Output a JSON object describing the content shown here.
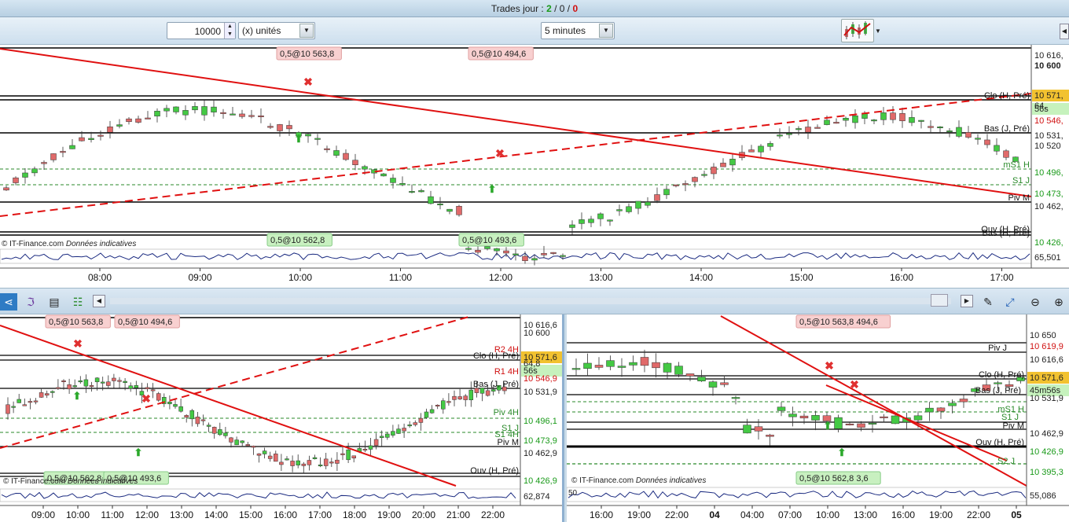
{
  "titlebar": {
    "label": "Trades jour : ",
    "win": "2",
    "sep1": " / ",
    "neutral": "0",
    "sep2": " / ",
    "loss": "0"
  },
  "toolbar": {
    "quantity": "10000",
    "unit_select": "(x) unités",
    "interval_select": "5 minutes"
  },
  "colors": {
    "up": "#44c944",
    "down": "#e06a6a",
    "trend": "#e01010",
    "accent_price": "#f2c230"
  },
  "main": {
    "watermark": "© IT-Finance.com",
    "watermark_note": "Données indicatives",
    "indicator_value": "65,501",
    "order_tags": [
      "0,5@10 563,8",
      "0,5@10 494,6",
      "0,5@10 562,8",
      "0,5@10 493,6"
    ],
    "price_labels": [
      {
        "text": "10 616,",
        "color": "#222"
      },
      {
        "text": "10 600",
        "color": "#222",
        "bold": true
      },
      {
        "text": "10 571,",
        "color": "#222",
        "highlight": true
      },
      {
        "text": "56s",
        "color": "#222",
        "green": true
      },
      {
        "text": "64,",
        "color": "#222"
      },
      {
        "text": "10 546,",
        "color": "#d01010"
      },
      {
        "text": "10 531,",
        "color": "#222"
      },
      {
        "text": "10 520",
        "color": "#222"
      },
      {
        "text": "10 496,",
        "color": "#1a9a1a"
      },
      {
        "text": "10 473,",
        "color": "#1a9a1a"
      },
      {
        "text": "10 462,",
        "color": "#222"
      },
      {
        "text": "10 426,",
        "color": "#1a9a1a"
      }
    ],
    "line_labels": [
      "Clo (H, Pré)",
      "Bas (J, Pré)",
      "mS1 H",
      "S1 J",
      "Piv M",
      "Ouv (H, Pré)",
      "Bas (H, Pré)"
    ],
    "x_labels": [
      "08:00",
      "09:00",
      "10:00",
      "11:00",
      "12:00",
      "13:00",
      "14:00",
      "15:00",
      "16:00",
      "17:00"
    ]
  },
  "bottom_left": {
    "watermark": "© IT-Finance.com",
    "watermark_note": "Données indicatives",
    "indicator_value": "62,874",
    "order_tags": [
      "0,5@10 563,8",
      "0,5@10 494,6",
      "0,5@10 562,8",
      "0,5@10 493,6"
    ],
    "price_labels": [
      {
        "text": "10 616,6",
        "color": "#222"
      },
      {
        "text": "10 600",
        "color": "#222"
      },
      {
        "text": "10 571,6",
        "color": "#222",
        "highlight": true
      },
      {
        "text": "56s",
        "color": "#222",
        "green": true
      },
      {
        "text": "64,8",
        "color": "#222"
      },
      {
        "text": "10 546,9",
        "color": "#d01010"
      },
      {
        "text": "10 531,9",
        "color": "#222"
      },
      {
        "text": "10 496,1",
        "color": "#1a9a1a"
      },
      {
        "text": "10 473,9",
        "color": "#1a9a1a"
      },
      {
        "text": "10 462,9",
        "color": "#222"
      },
      {
        "text": "10 426,9",
        "color": "#1a9a1a"
      }
    ],
    "line_labels": [
      "R2 4H",
      "Clo (H, Pré)",
      "R1 4H",
      "Bas (J, Pré)",
      "Piv 4H",
      "S1 J",
      "S1 4H",
      "Piv M",
      "Ouv (H, Pré)"
    ],
    "x_labels": [
      "09:00",
      "10:00",
      "11:00",
      "12:00",
      "13:00",
      "14:00",
      "15:00",
      "16:00",
      "17:00",
      "18:00",
      "19:00",
      "20:00",
      "21:00",
      "22:00"
    ]
  },
  "bottom_right": {
    "watermark": "© IT-Finance.com",
    "watermark_note": "Données indicatives",
    "indicator_value": "55,086",
    "indicator_tick": "50",
    "order_tags": [
      "0,5@10 563,8 494,6",
      "0,5@10 562,8 3,6"
    ],
    "price_labels": [
      {
        "text": "10 650",
        "color": "#222"
      },
      {
        "text": "10 619,9",
        "color": "#d01010"
      },
      {
        "text": "10 616,6",
        "color": "#222"
      },
      {
        "text": "10 571,6",
        "color": "#222",
        "highlight": true
      },
      {
        "text": "45m56s",
        "color": "#222",
        "green": true
      },
      {
        "text": "10 531,9",
        "color": "#222"
      },
      {
        "text": "10 462,9",
        "color": "#222"
      },
      {
        "text": "10 426,9",
        "color": "#1a9a1a"
      },
      {
        "text": "10 395,3",
        "color": "#1a9a1a"
      }
    ],
    "line_labels": [
      "Piv J",
      "Clo (H, Pré)",
      "Bas (J, Pré)",
      "mS1 H",
      "S1 J",
      "Piv M",
      "Ouv (H, Pré)",
      "S2 J"
    ],
    "x_labels": [
      "16:00",
      "19:00",
      "22:00",
      "04",
      "04:00",
      "07:00",
      "10:00",
      "13:00",
      "16:00",
      "19:00",
      "22:00",
      "05"
    ]
  }
}
